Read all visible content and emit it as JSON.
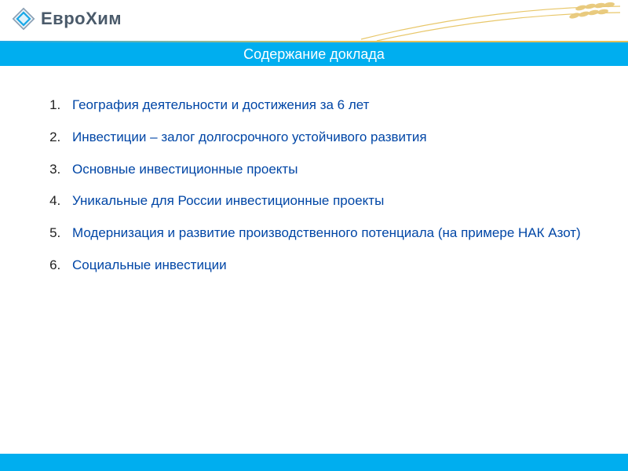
{
  "header": {
    "company_name": "ЕвроХим"
  },
  "title": "Содержание доклада",
  "toc": {
    "items": [
      "География деятельности и достижения за 6 лет",
      "Инвестиции – залог долгосрочного устойчивого развития",
      "Основные инвестиционные проекты",
      "Уникальные для России инвестиционные проекты",
      "Модернизация и развитие производственного потенциала (на примере НАК Азот)",
      "Социальные инвестиции"
    ]
  },
  "colors": {
    "accent": "#00aeef",
    "link": "#0046a6"
  }
}
